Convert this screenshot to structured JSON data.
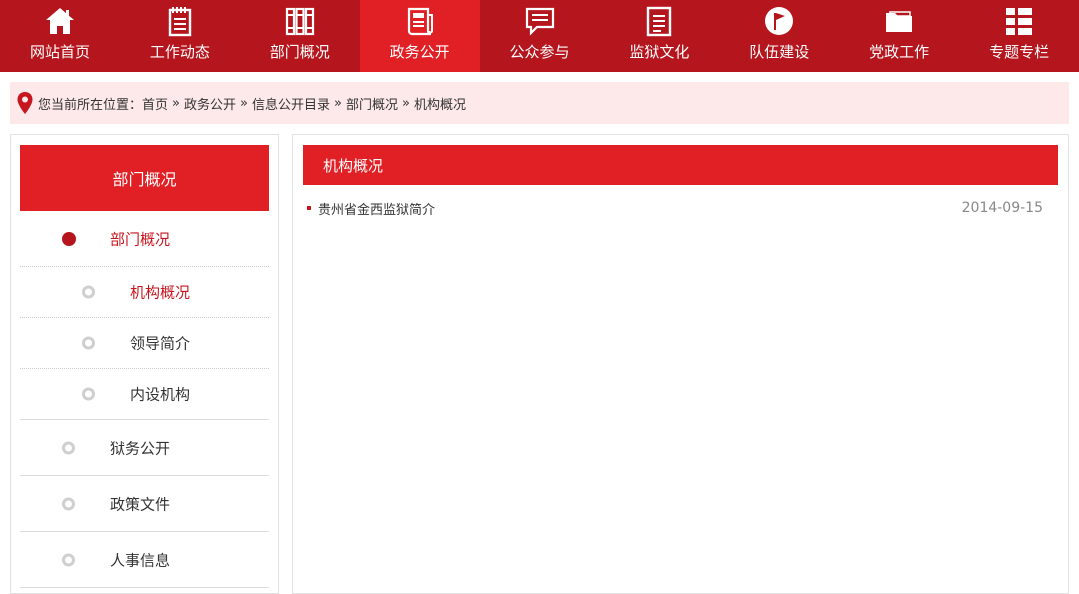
{
  "nav": {
    "items": [
      {
        "label": "网站首页",
        "icon": "home-icon"
      },
      {
        "label": "工作动态",
        "icon": "notepad-icon"
      },
      {
        "label": "部门概况",
        "icon": "books-icon"
      },
      {
        "label": "政务公开",
        "icon": "newspaper-icon",
        "active": true
      },
      {
        "label": "公众参与",
        "icon": "chat-icon"
      },
      {
        "label": "监狱文化",
        "icon": "document-icon"
      },
      {
        "label": "队伍建设",
        "icon": "flag-icon"
      },
      {
        "label": "党政工作",
        "icon": "folder-icon"
      },
      {
        "label": "专题专栏",
        "icon": "grid-list-icon"
      }
    ],
    "colors": {
      "bar": "#b5161e",
      "active": "#e02025"
    }
  },
  "breadcrumb": {
    "prefix": "您当前所在位置：",
    "items": [
      "首页",
      "政务公开",
      "信息公开目录",
      "部门概况",
      "机构概况"
    ],
    "separator": "»"
  },
  "sidebar": {
    "title": "部门概况",
    "items": [
      {
        "label": "部门概况",
        "level": 1,
        "state": "active"
      },
      {
        "label": "机构概况",
        "level": 2,
        "state": "current"
      },
      {
        "label": "领导简介",
        "level": 2,
        "state": "normal"
      },
      {
        "label": "内设机构",
        "level": 2,
        "state": "normal"
      },
      {
        "label": "狱务公开",
        "level": 1,
        "state": "normal"
      },
      {
        "label": "政策文件",
        "level": 1,
        "state": "normal"
      },
      {
        "label": "人事信息",
        "level": 1,
        "state": "normal"
      }
    ]
  },
  "main": {
    "title": "机构概况",
    "articles": [
      {
        "title": "贵州省金西监狱简介",
        "date": "2014-09-15"
      }
    ]
  }
}
